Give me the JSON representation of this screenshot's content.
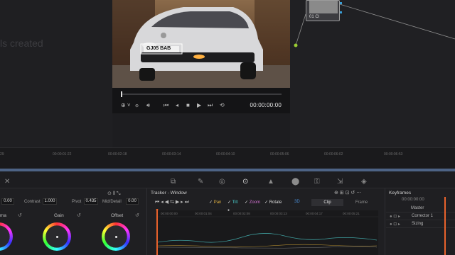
{
  "gallery": {
    "message": "ls created"
  },
  "viewer": {
    "timecode": "00:00:00:00",
    "plate_text": "GJ05 BAB"
  },
  "node": {
    "label": "01 Cl"
  },
  "ruler": [
    "00:00:01:22",
    "00:00:02:18",
    "00:00:03:14",
    "00:00:04:10",
    "00:00:05:06",
    "00:00:06:02",
    "00:00:06:53"
  ],
  "primaries": {
    "contrast_label": "Contrast",
    "contrast_value": "1.000",
    "pivot_label": "Pivot",
    "pivot_value": "0.435",
    "middetail_label": "Mid/Detail",
    "middetail_value": "0.00",
    "left_value": "0.00",
    "wheel_gamma": "ma",
    "wheel_gain": "Gain",
    "wheel_offset": "Offset"
  },
  "tracker": {
    "title": "Tracker - Window",
    "checks": [
      "Pan",
      "Tilt",
      "Zoom",
      "Rotate",
      "3D"
    ],
    "clip_tab": "Clip",
    "frame_tab": "Frame",
    "timecodes": [
      "00:00:00:00",
      "00:00:01:04",
      "00:00:02:08",
      "00:00:03:13",
      "00:00:04:17",
      "00:00:05:21"
    ]
  },
  "keyframes": {
    "title": "Keyframes",
    "timecode": "00:00:00:00",
    "rows": [
      "Master",
      "Corrector 1",
      "Sizing"
    ]
  },
  "colors": {
    "accent_orange": "#e8622c",
    "blue_strip": "#4d6385",
    "pan_color": "#e0b040",
    "tilt_color": "#4bd0d0",
    "zoom_color": "#d070d0"
  }
}
